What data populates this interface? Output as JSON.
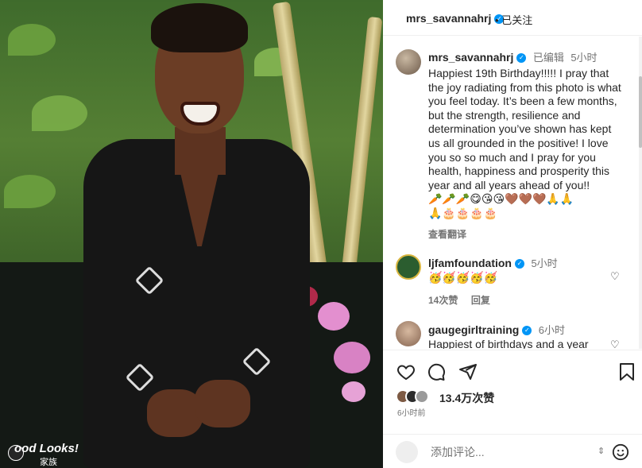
{
  "photo": {
    "overlay_text": "ood Looks!",
    "overlay_sub": "家族"
  },
  "header": {
    "username": "mrs_savannahrj",
    "follow_label": "已关注"
  },
  "caption": {
    "username": "mrs_savannahrj",
    "edited": "已编辑",
    "time": "5小时",
    "text": "Happiest 19th Birthday!!!!! I pray that the joy radiating from this photo is what you feel today. It’s been a few months, but the strength, resilience and determination you’ve shown has kept us all grounded in the positive! I love you so so much and I pray for you health, happiness and prosperity this year and all years ahead of you!!",
    "emojis_1": "🥕🥕🥕😋😘😘🤎🤎🤎🙏🙏",
    "emojis_2": "🙏🎂🎂🎂🎂",
    "translate": "查看翻译"
  },
  "comments": [
    {
      "username": "ljfamfoundation",
      "time": "5小时",
      "text": "🥳🥳🥳🥳🥳",
      "likes": "14次赞",
      "reply": "回复"
    },
    {
      "username": "gaugegirltraining",
      "time": "6小时",
      "text": "Happiest of birthdays and a year"
    }
  ],
  "actions": {
    "likes_count": "13.4万次赞",
    "timestamp": "6小时前"
  },
  "add_comment": {
    "placeholder": "添加评论..."
  },
  "colors": {
    "verified": "#0095f6",
    "text": "#262626",
    "muted": "#737373"
  }
}
